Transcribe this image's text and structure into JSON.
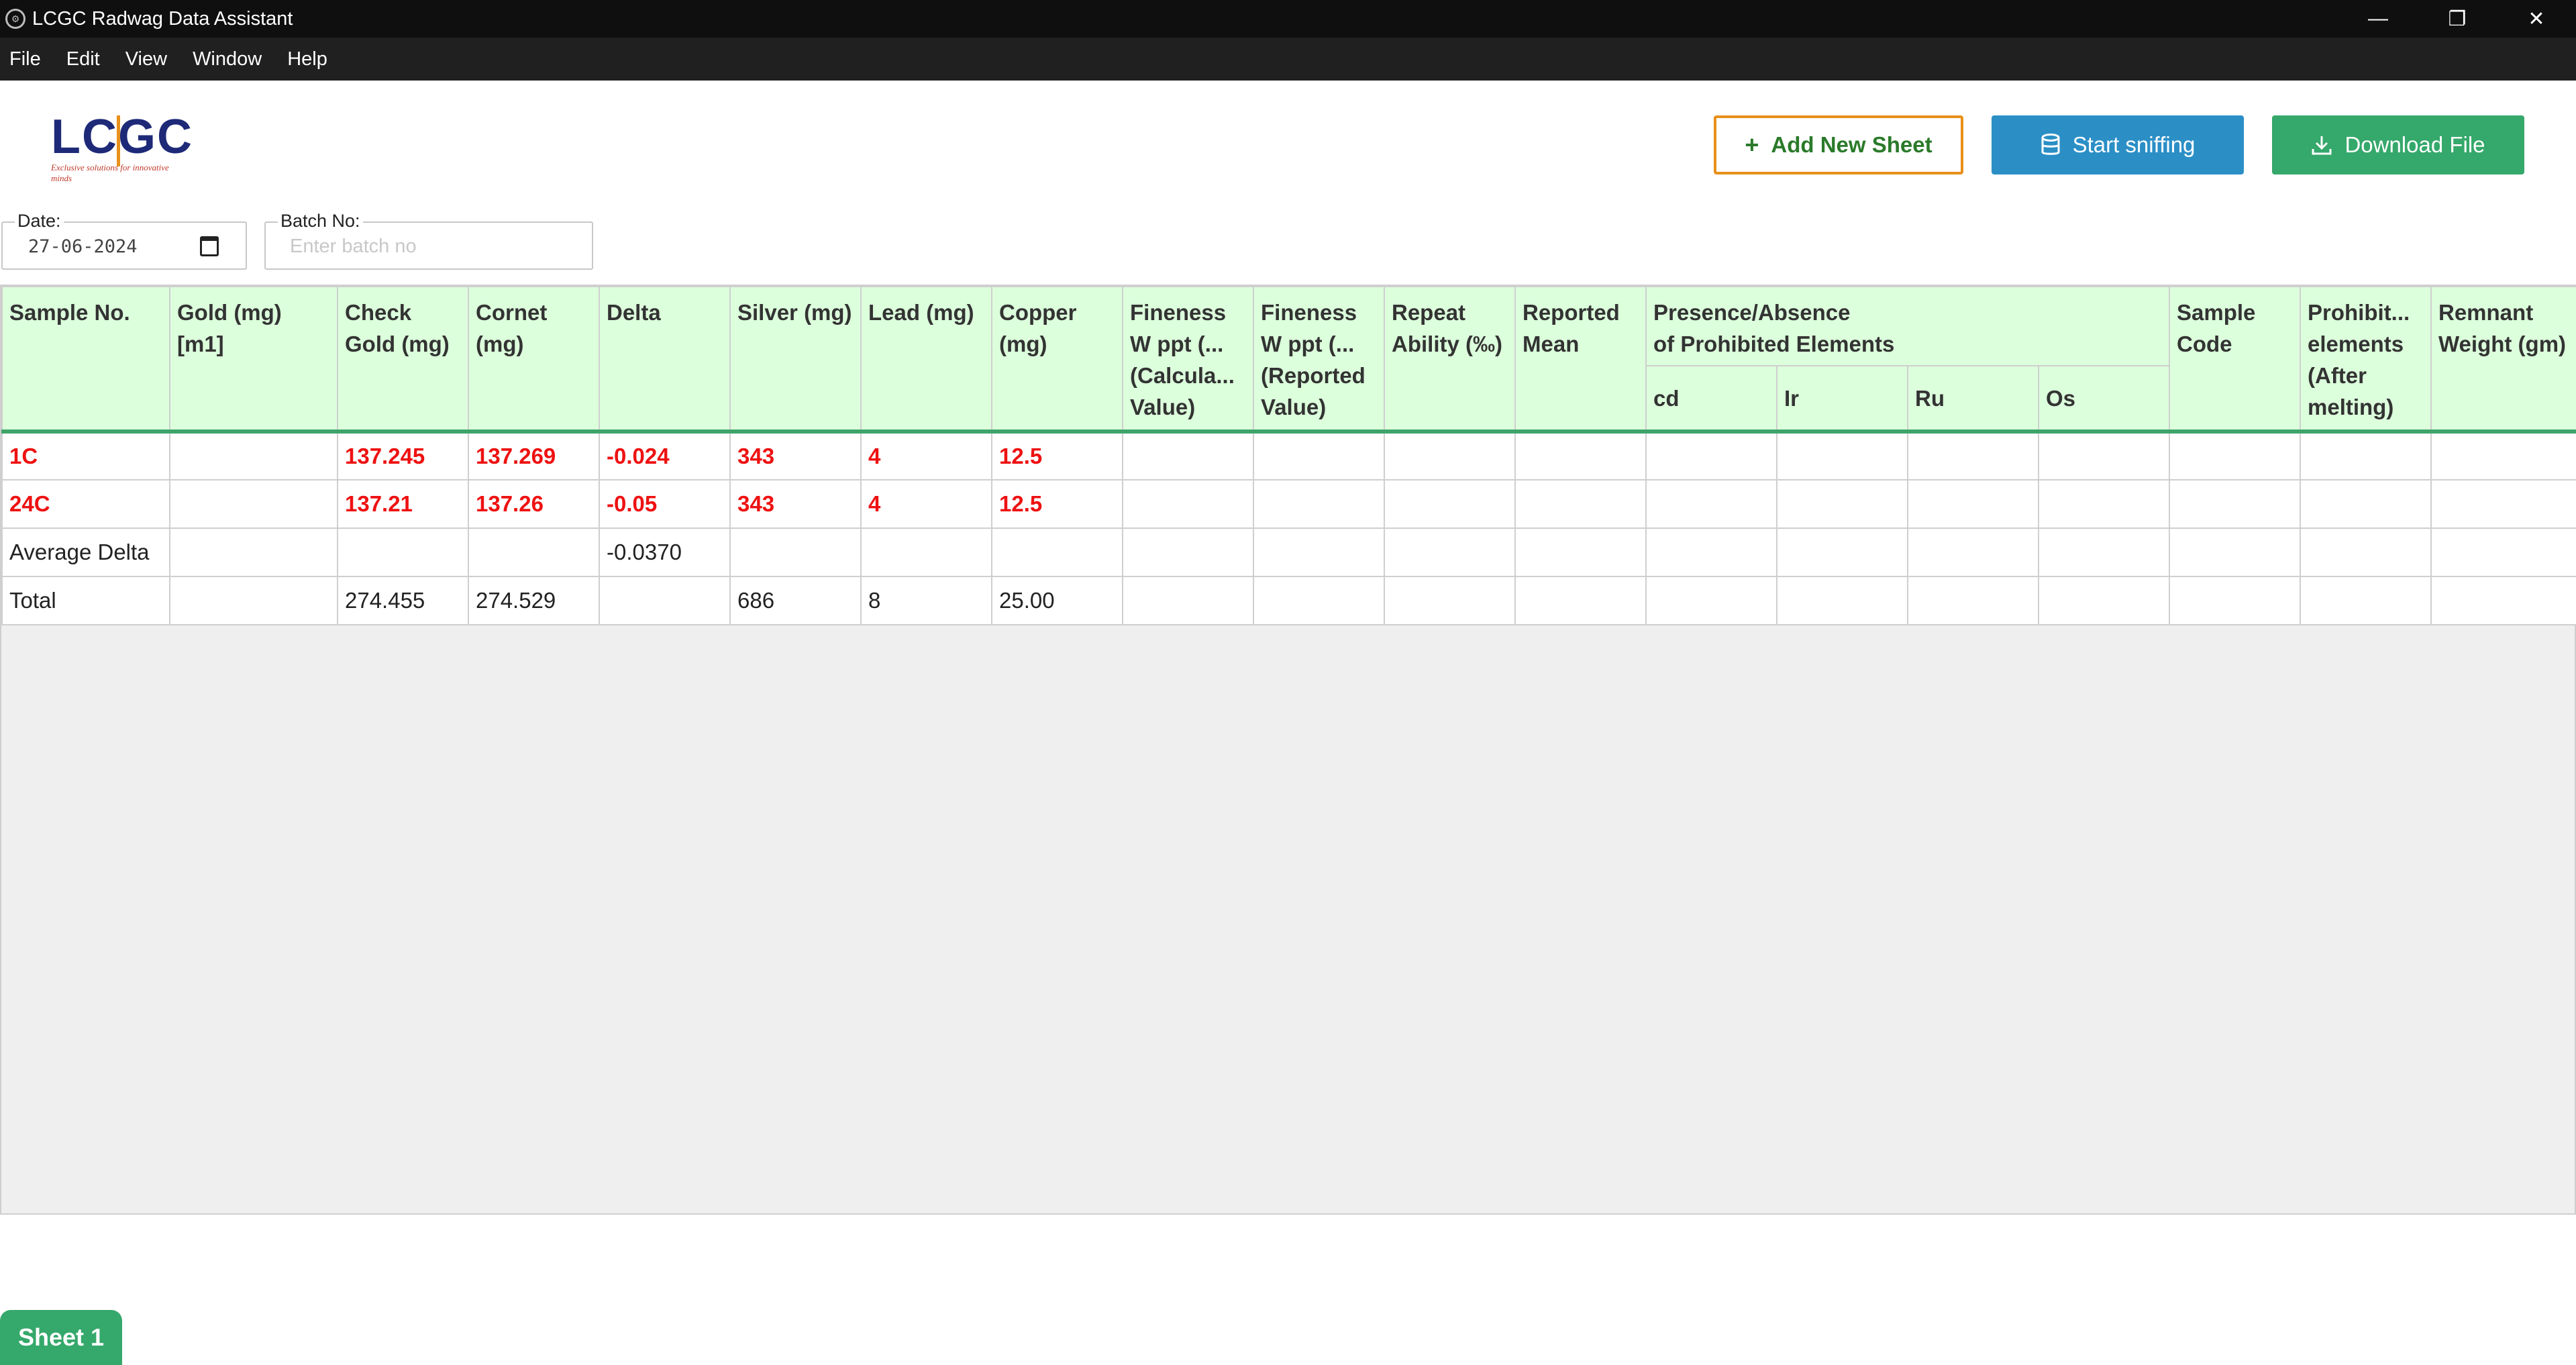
{
  "window": {
    "title": "LCGC Radwag Data Assistant"
  },
  "menu": [
    "File",
    "Edit",
    "View",
    "Window",
    "Help"
  ],
  "logo": {
    "text": "LCGC",
    "tagline": "Exclusive solutions for innovative minds"
  },
  "buttons": {
    "add": "Add New Sheet",
    "sniff": "Start sniffing",
    "download": "Download File"
  },
  "fields": {
    "date_label": "Date:",
    "date_value": "27-06-2024",
    "batch_label": "Batch No:",
    "batch_placeholder": "Enter batch no"
  },
  "table": {
    "headers": {
      "sample_no": "Sample No.",
      "gold": "Gold (mg) [m1]",
      "check_gold": "Check Gold (mg)",
      "cornet": "Cornet (mg)",
      "delta": "Delta",
      "silver": "Silver (mg)",
      "lead": "Lead (mg)",
      "copper": "Copper (mg)",
      "fineness_calc_l1": "Fineness",
      "fineness_calc_l2": "W ppt (...",
      "fineness_calc_l3": "(Calcula...",
      "fineness_calc_l4": "Value)",
      "fineness_rep_l1": "Fineness",
      "fineness_rep_l2": "W ppt (...",
      "fineness_rep_l3": "(Reported",
      "fineness_rep_l4": "Value)",
      "repeat_ability": "Repeat Ability (‰)",
      "reported_mean": "Reported Mean",
      "presence_l1": "Presence/Absence",
      "presence_l2": "of Prohibited Elements",
      "cd": "cd",
      "ir": "Ir",
      "ru": "Ru",
      "os": "Os",
      "sample_code": "Sample Code",
      "prohibited_l1": "Prohibit...",
      "prohibited_l2": "elements",
      "prohibited_l3": "(After",
      "prohibited_l4": "melting)",
      "remnant": "Remnant Weight (gm)"
    },
    "rows": [
      {
        "sample": "1C",
        "gold": "",
        "check_gold": "137.245",
        "cornet": "137.269",
        "delta": "-0.024",
        "silver": "343",
        "lead": "4",
        "copper": "12.5"
      },
      {
        "sample": "24C",
        "gold": "",
        "check_gold": "137.21",
        "cornet": "137.26",
        "delta": "-0.05",
        "silver": "343",
        "lead": "4",
        "copper": "12.5"
      },
      {
        "sample": "Average Delta",
        "gold": "",
        "check_gold": "",
        "cornet": "",
        "delta": "-0.0370",
        "silver": "",
        "lead": "",
        "copper": ""
      },
      {
        "sample": "Total",
        "gold": "",
        "check_gold": "274.455",
        "cornet": "274.529",
        "delta": "",
        "silver": "686",
        "lead": "8",
        "copper": "25.00"
      }
    ]
  },
  "sheet_tab": "Sheet 1",
  "colors": {
    "accent_green": "#35a86b",
    "accent_blue": "#2b8fc6",
    "accent_orange": "#e8901a",
    "header_bg": "#dcffdc",
    "highlight_red": "#ee1111"
  }
}
